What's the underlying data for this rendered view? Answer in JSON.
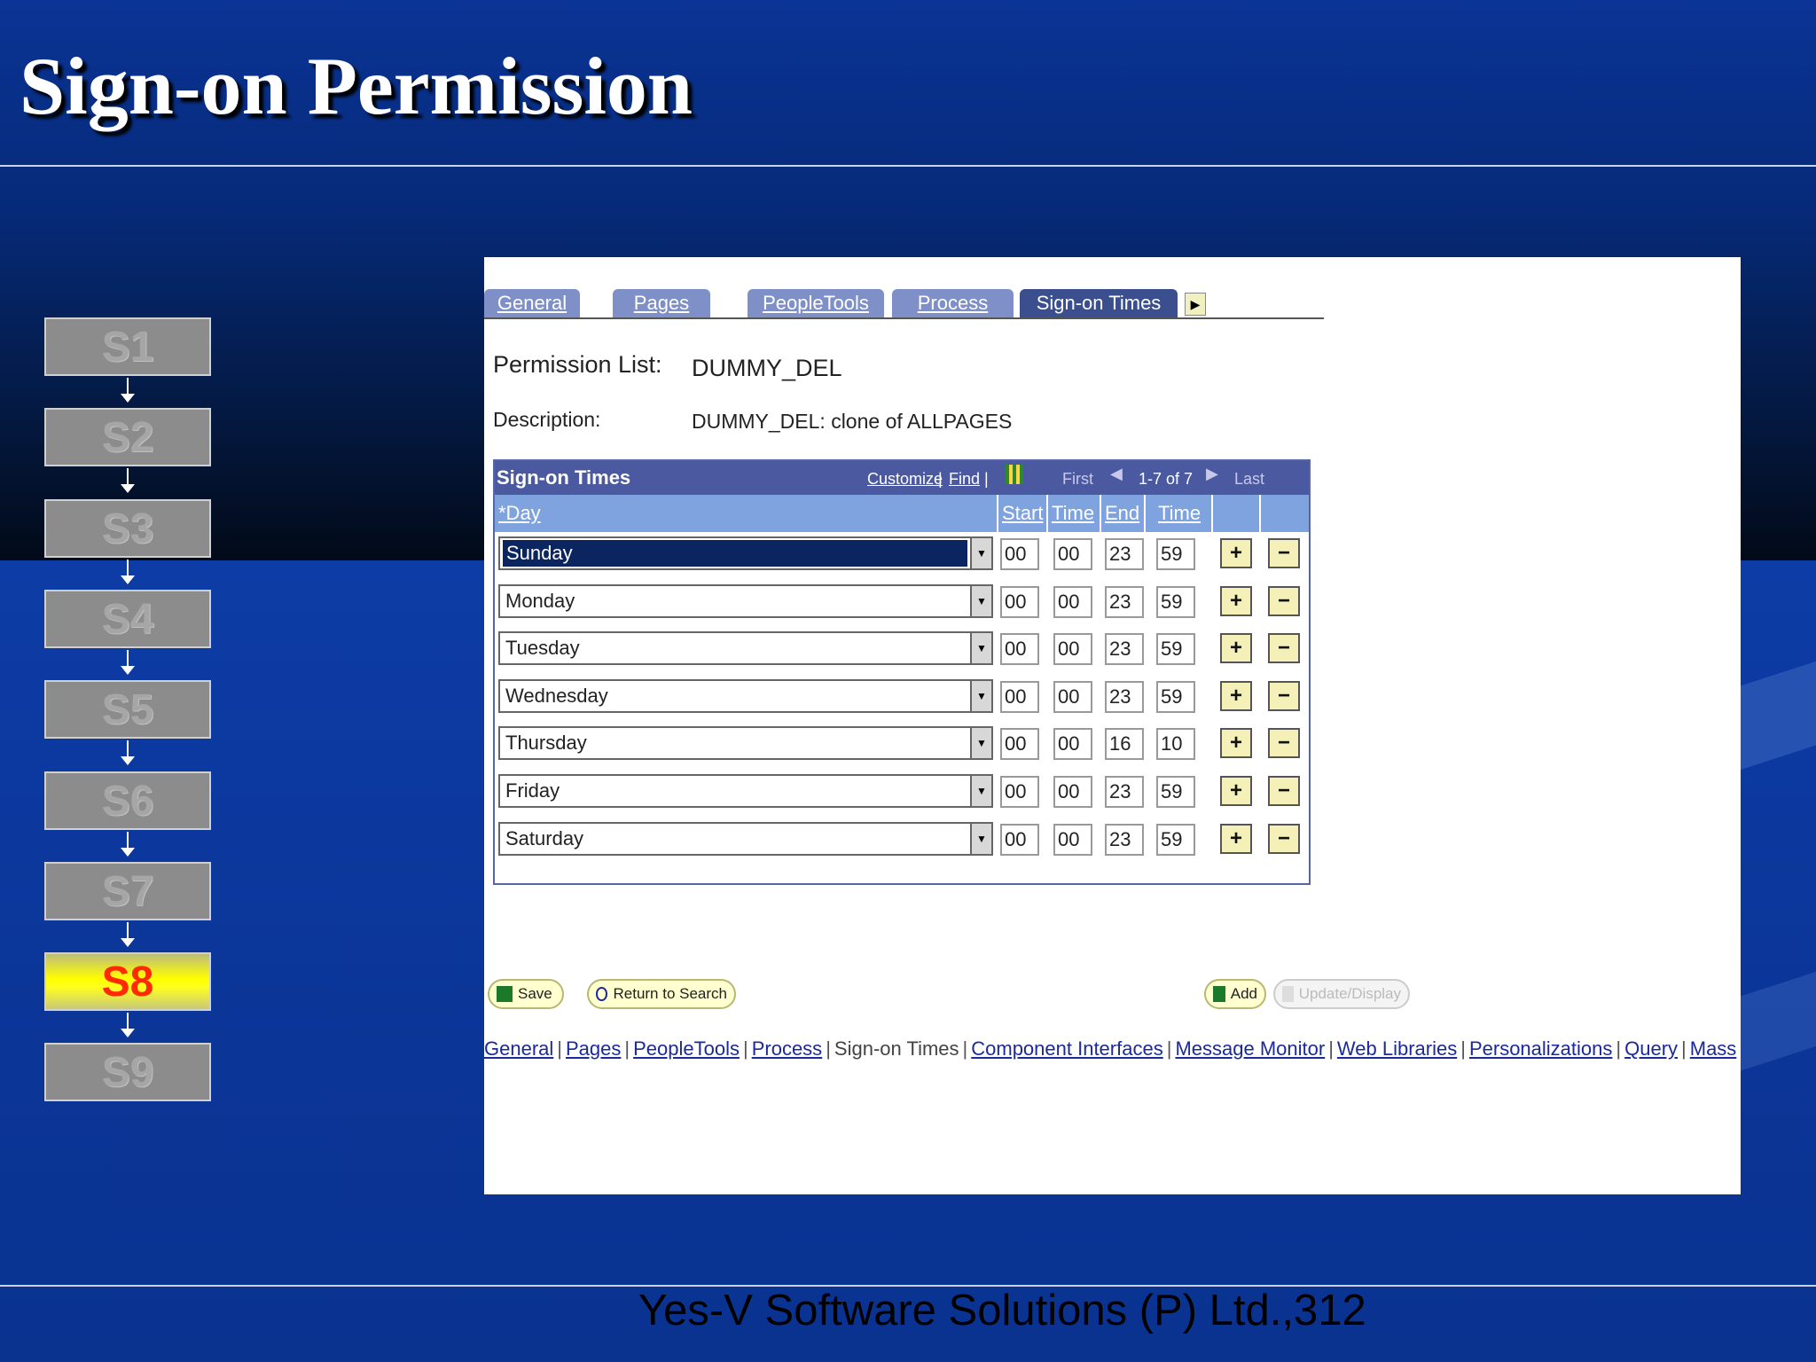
{
  "slide": {
    "title": "Sign-on Permission",
    "footer": "Yes-V Software Solutions (P) Ltd.,312"
  },
  "steps": [
    "S1",
    "S2",
    "S3",
    "S4",
    "S5",
    "S6",
    "S7",
    "S8",
    "S9"
  ],
  "active_step": "S8",
  "app": {
    "tabs": [
      {
        "label": "General",
        "active": false
      },
      {
        "label": "Pages",
        "active": false
      },
      {
        "label": "PeopleTools",
        "active": false
      },
      {
        "label": "Process",
        "active": false
      },
      {
        "label": "Sign-on Times",
        "active": true
      }
    ],
    "permission_list_label": "Permission List:",
    "permission_list_value": "DUMMY_DEL",
    "description_label": "Description:",
    "description_value": "DUMMY_DEL: clone of ALLPAGES",
    "grid": {
      "title": "Sign-on Times",
      "customize": "Customize",
      "find": "Find",
      "first": "First",
      "range": "1-7 of 7",
      "last": "Last",
      "col_day": "*Day",
      "col_start": "Start",
      "col_time1": "Time",
      "col_end": "End",
      "col_time2": "Time",
      "rows": [
        {
          "day": "Sunday",
          "start_h": "00",
          "start_m": "00",
          "end_h": "23",
          "end_m": "59"
        },
        {
          "day": "Monday",
          "start_h": "00",
          "start_m": "00",
          "end_h": "23",
          "end_m": "59"
        },
        {
          "day": "Tuesday",
          "start_h": "00",
          "start_m": "00",
          "end_h": "23",
          "end_m": "59"
        },
        {
          "day": "Wednesday",
          "start_h": "00",
          "start_m": "00",
          "end_h": "23",
          "end_m": "59"
        },
        {
          "day": "Thursday",
          "start_h": "00",
          "start_m": "00",
          "end_h": "16",
          "end_m": "10"
        },
        {
          "day": "Friday",
          "start_h": "00",
          "start_m": "00",
          "end_h": "23",
          "end_m": "59"
        },
        {
          "day": "Saturday",
          "start_h": "00",
          "start_m": "00",
          "end_h": "23",
          "end_m": "59"
        }
      ],
      "add_symbol": "+",
      "remove_symbol": "−"
    },
    "buttons": {
      "save": "Save",
      "return_to_search": "Return to Search",
      "add": "Add",
      "update_display": "Update/Display"
    },
    "bottom_links": [
      "General",
      "Pages",
      "PeopleTools",
      "Process",
      "Sign-on Times",
      "Component Interfaces",
      "Message Monitor",
      "Web Libraries",
      "Personalizations",
      "Query",
      "Mass"
    ],
    "bottom_links_current": "Sign-on Times"
  },
  "colors": {
    "active_step_bg": "#ffff00",
    "active_step_text": "#ff2a00",
    "grid_header": "#4b5aa0",
    "grid_subheader": "#7ea3de"
  }
}
